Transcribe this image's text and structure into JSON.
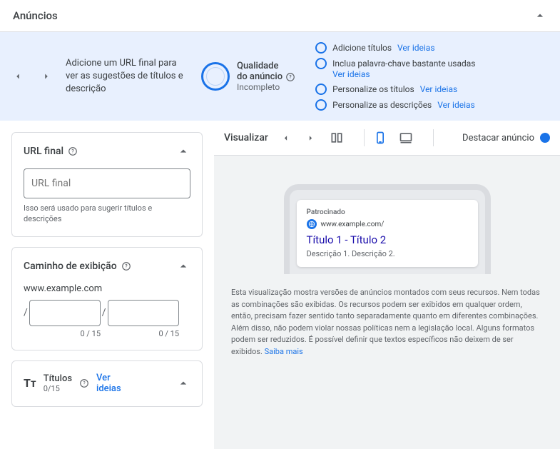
{
  "header": {
    "title": "Anúncios"
  },
  "banner": {
    "instruction": "Adicione um URL final para ver as sugestões de títulos e descrição",
    "quality_label1": "Qualidade",
    "quality_label2": "do anúncio",
    "quality_status": "Incompleto"
  },
  "suggestions": [
    {
      "label": "Adicione títulos",
      "link": "Ver ideias"
    },
    {
      "label": "Inclua palavra-chave bastante usadas",
      "link": "Ver ideias",
      "stacked": true
    },
    {
      "label": "Personalize os títulos",
      "link": "Ver ideias"
    },
    {
      "label": "Personalize as descrições",
      "link": "Ver ideias"
    }
  ],
  "url_final": {
    "title": "URL final",
    "placeholder": "URL final",
    "hint": "Isso será usado para sugerir títulos e descrições"
  },
  "display_path": {
    "title": "Caminho de exibição",
    "domain": "www.example.com",
    "counter1": "0 / 15",
    "counter2": "0 / 15"
  },
  "titulos": {
    "label": "Títulos",
    "count": "0/15",
    "link1": "Ver",
    "link2": "ideias"
  },
  "preview": {
    "title": "Visualizar",
    "destacar": "Destacar anúncio",
    "sponsored": "Patrocinado",
    "ad_url": "www.example.com/",
    "ad_title": "Título 1 - Título 2",
    "ad_desc": "Descrição 1. Descrição 2.",
    "disclaimer": "Esta visualização mostra versões de anúncios montados com seus recursos. Nem todas as combinações são exibidas. Os recursos podem ser exibidos em qualquer ordem, então, precisam fazer sentido tanto separadamente quanto em diferentes combinações. Além disso, não podem violar nossas políticas nem a legislação local. Alguns formatos podem ser reduzidos. É possível definir que textos específicos não deixem de ser exibidos. ",
    "learn_more": "Saiba mais"
  }
}
